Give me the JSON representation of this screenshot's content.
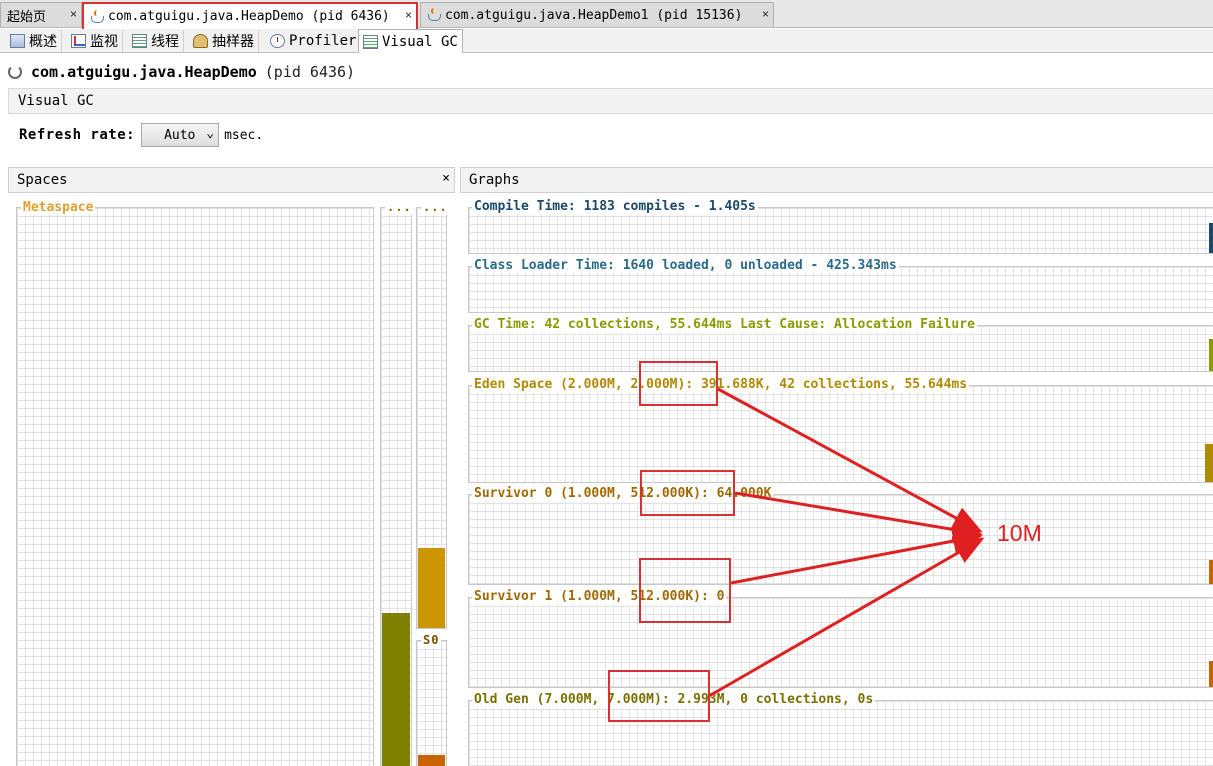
{
  "doc_tabs": [
    {
      "label": "起始页",
      "close": "×"
    },
    {
      "label": "com.atguigu.java.HeapDemo (pid 6436)",
      "close": "×"
    },
    {
      "label": "com.atguigu.java.HeapDemo1 (pid 15136)",
      "close": "×"
    }
  ],
  "sub_tabs": [
    {
      "label": "概述",
      "icon": "overview-icon"
    },
    {
      "label": "监视",
      "icon": "monitor-icon"
    },
    {
      "label": "线程",
      "icon": "threads-icon"
    },
    {
      "label": "抽样器",
      "icon": "sampler-icon"
    },
    {
      "label": "Profiler",
      "icon": "profiler-icon"
    },
    {
      "label": "Visual GC",
      "icon": "visual-gc-icon"
    }
  ],
  "header": {
    "title": "com.atguigu.java.HeapDemo",
    "pid": "(pid 6436)"
  },
  "visual_gc_title": "Visual GC",
  "refresh": {
    "label": "Refresh rate:",
    "value": "Auto",
    "unit": "msec."
  },
  "spaces": {
    "title": "Spaces",
    "close": "×",
    "metaspace_label": "Metaspace",
    "old_label": "...",
    "eden_label": "...",
    "s0_label": "S0",
    "old_fill": 0.28,
    "eden_fill": 0.19,
    "s0_fill": 0.12
  },
  "graphs": {
    "title": "Graphs",
    "compile": "Compile Time: 1183 compiles - 1.405s",
    "class_loader": "Class Loader Time: 1640 loaded, 0 unloaded - 425.343ms",
    "gc_time": "GC Time: 42 collections, 55.644ms Last Cause: Allocation Failure",
    "eden": "Eden Space (2.000M, 2.000M): 391.688K, 42 collections, 55.644ms",
    "survivor0": "Survivor 0 (1.000M, 512.000K): 64.000K",
    "survivor1": "Survivor 1 (1.000M, 512.000K): 0",
    "old_gen": "Old Gen (7.000M, 7.000M): 2.993M, 0 collections, 0s"
  },
  "annotation": {
    "label": "10M",
    "color": "#e02020"
  },
  "colors": {
    "old_bar": "#808000",
    "eden_bar": "#cc9600",
    "s0_bar": "#c86400",
    "metaspace_label": "#e0a030"
  }
}
